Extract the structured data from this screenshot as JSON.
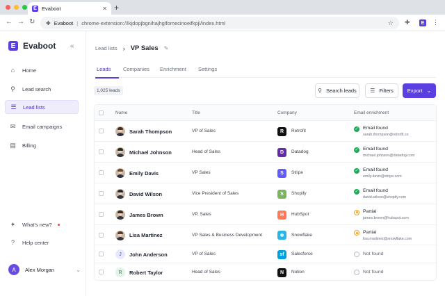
{
  "browser": {
    "tab_title": "Evaboot",
    "tab_close": "✕",
    "new_tab": "+",
    "ext_name": "Evaboot",
    "url": "chrome-extension://lkjdopjbgnihajhglfomecinoeifkpjl/index.html"
  },
  "sidebar": {
    "brand": "Evaboot",
    "brand_letter": "E",
    "collapse": "«",
    "nav": [
      {
        "label": "Home",
        "icon": "home-icon"
      },
      {
        "label": "Lead search",
        "icon": "search-icon"
      },
      {
        "label": "Lead lists",
        "icon": "list-icon",
        "active": true
      },
      {
        "label": "Email campaigns",
        "icon": "mail-icon"
      },
      {
        "label": "Billing",
        "icon": "billing-icon"
      }
    ],
    "whats_new": "What's new?",
    "help": "Help center",
    "user": {
      "name": "Alex Morgan",
      "initial": "A"
    }
  },
  "header": {
    "crumb_parent": "Lead lists",
    "crumb_current": "VP Sales"
  },
  "tabs": [
    "Leads",
    "Companies",
    "Enrichment",
    "Settings"
  ],
  "toolbar": {
    "count": "1,025 leads",
    "search": "Search leads",
    "filters": "Filters",
    "export": "Export"
  },
  "table": {
    "columns": [
      "Name",
      "Title",
      "Company",
      "Email enrichment"
    ],
    "rows": [
      {
        "name": "Sarah Thompson",
        "title": "VP of Sales",
        "company": "Retrofit",
        "company_color": "#111111",
        "company_letter": "R",
        "status": "Email found",
        "status_type": "found",
        "email": "sarah.thompson@retrofit.co"
      },
      {
        "name": "Michael Johnson",
        "title": "Head of Sales",
        "company": "Datadog",
        "company_color": "#632ca6",
        "company_letter": "D",
        "status": "Email found",
        "status_type": "found",
        "email": "michael.johnson@datadog.com"
      },
      {
        "name": "Emily Davis",
        "title": "VP Sales",
        "company": "Stripe",
        "company_color": "#635bff",
        "company_letter": "S",
        "status": "Email found",
        "status_type": "found",
        "email": "emily.davis@stripe.com"
      },
      {
        "name": "David Wilson",
        "title": "Vice President of Sales",
        "company": "Shopify",
        "company_color": "#7ab55c",
        "company_letter": "S",
        "status": "Email found",
        "status_type": "found",
        "email": "david.wilson@shopify.com"
      },
      {
        "name": "James Brown",
        "title": "VP, Sales",
        "company": "HubSpot",
        "company_color": "#ff7a59",
        "company_letter": "H",
        "status": "Partial",
        "status_type": "partial",
        "email": "james.brown@hubspot.com"
      },
      {
        "name": "Lisa Martinez",
        "title": "VP Sales & Business Development",
        "company": "Snowflake",
        "company_color": "#29b5e8",
        "company_letter": "❄",
        "status": "Partial",
        "status_type": "partial",
        "email": "lisa.martinez@snowflake.com"
      },
      {
        "name": "John Anderson",
        "title": "VP of Sales",
        "company": "Salesforce",
        "company_color": "#00a1e0",
        "company_letter": "sf",
        "status": "Not found",
        "status_type": "none",
        "email": "",
        "initial": "J"
      },
      {
        "name": "Robert Taylor",
        "title": "Head of Sales",
        "company": "Notion",
        "company_color": "#111111",
        "company_letter": "N",
        "status": "Not found",
        "status_type": "none",
        "email": "",
        "initial": "R"
      }
    ]
  }
}
